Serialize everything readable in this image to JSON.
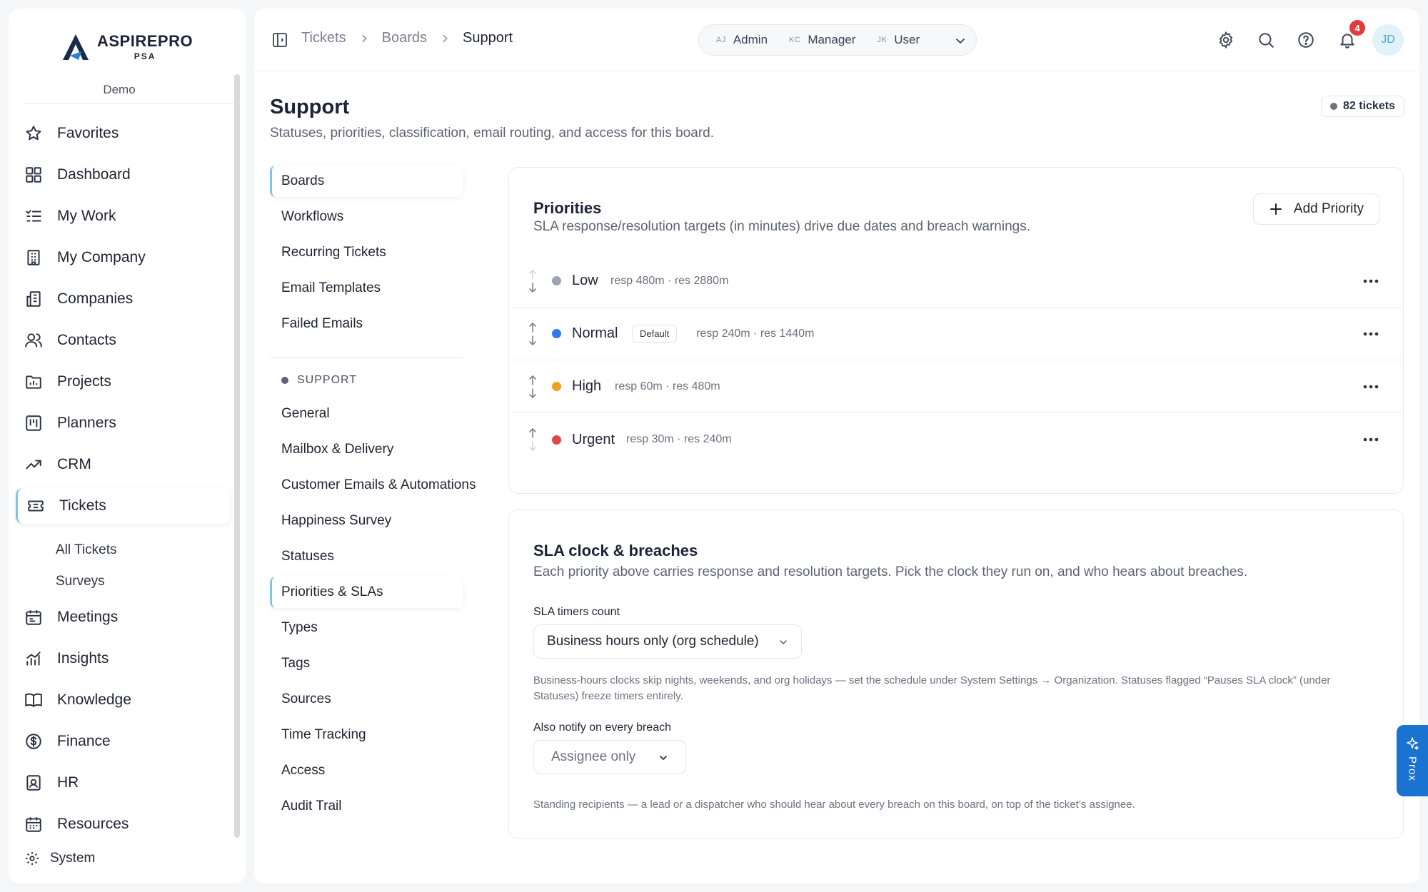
{
  "brand": {
    "name": "ASPIREPRO",
    "sub": "PSA",
    "workspace": "Demo"
  },
  "sidebar": {
    "items": [
      {
        "label": "Favorites",
        "icon": "star-icon"
      },
      {
        "label": "Dashboard",
        "icon": "dashboard-icon"
      },
      {
        "label": "My Work",
        "icon": "checklist-icon"
      },
      {
        "label": "My Company",
        "icon": "building-icon"
      },
      {
        "label": "Companies",
        "icon": "companies-icon"
      },
      {
        "label": "Contacts",
        "icon": "users-icon"
      },
      {
        "label": "Projects",
        "icon": "folder-chart-icon"
      },
      {
        "label": "Planners",
        "icon": "kanban-icon"
      },
      {
        "label": "CRM",
        "icon": "trend-up-icon"
      },
      {
        "label": "Tickets",
        "icon": "ticket-icon",
        "active": true
      },
      {
        "label": "Meetings",
        "icon": "calendar-icon"
      },
      {
        "label": "Insights",
        "icon": "bar-chart-icon"
      },
      {
        "label": "Knowledge",
        "icon": "book-icon"
      },
      {
        "label": "Finance",
        "icon": "dollar-icon"
      },
      {
        "label": "HR",
        "icon": "id-badge-icon"
      },
      {
        "label": "Resources",
        "icon": "calendar-grid-icon"
      }
    ],
    "ticket_subitems": [
      "All Tickets",
      "Surveys"
    ],
    "system_label": "System"
  },
  "breadcrumb": [
    "Tickets",
    "Boards",
    "Support"
  ],
  "roles": [
    {
      "initials": "AJ",
      "label": "Admin"
    },
    {
      "initials": "KC",
      "label": "Manager"
    },
    {
      "initials": "JK",
      "label": "User"
    }
  ],
  "header": {
    "notification_count": "4",
    "avatar_initials": "JD"
  },
  "page": {
    "title": "Support",
    "subtitle": "Statuses, priorities, classification, email routing, and access for this board.",
    "ticket_count": "82 tickets"
  },
  "subnav": {
    "top": [
      "Boards",
      "Workflows",
      "Recurring Tickets",
      "Email Templates",
      "Failed Emails"
    ],
    "section": "SUPPORT",
    "board_items": [
      "General",
      "Mailbox & Delivery",
      "Customer Emails & Automations",
      "Happiness Survey",
      "Statuses",
      "Priorities & SLAs",
      "Types",
      "Tags",
      "Sources",
      "Time Tracking",
      "Access",
      "Audit Trail"
    ]
  },
  "priorities": {
    "title": "Priorities",
    "description": "SLA response/resolution targets (in minutes) drive due dates and breach warnings.",
    "add_label": "Add Priority",
    "rows": [
      {
        "name": "Low",
        "color": "#9ca3af",
        "sla": "resp 480m · res 2880m",
        "default": ""
      },
      {
        "name": "Normal",
        "color": "#2f7be8",
        "sla": "resp 240m · res 1440m",
        "default": "Default"
      },
      {
        "name": "High",
        "color": "#f0a01f",
        "sla": "resp 60m · res 480m",
        "default": ""
      },
      {
        "name": "Urgent",
        "color": "#e24545",
        "sla": "resp 30m · res 240m",
        "default": ""
      }
    ]
  },
  "sla": {
    "title": "SLA clock & breaches",
    "description": "Each priority above carries response and resolution targets. Pick the clock they run on, and who hears about breaches.",
    "timers_label": "SLA timers count",
    "timers_value": "Business hours only (org schedule)",
    "timers_help": "Business-hours clocks skip nights, weekends, and org holidays — set the schedule under System Settings → Organization. Statuses flagged “Pauses SLA clock” (under Statuses) freeze timers entirely.",
    "notify_label": "Also notify on every breach",
    "notify_placeholder": "Assignee only",
    "notify_help": "Standing recipients — a lead or a dispatcher who should hear about every breach on this board, on top of the ticket’s assignee."
  },
  "assistant_tab": "Prox"
}
